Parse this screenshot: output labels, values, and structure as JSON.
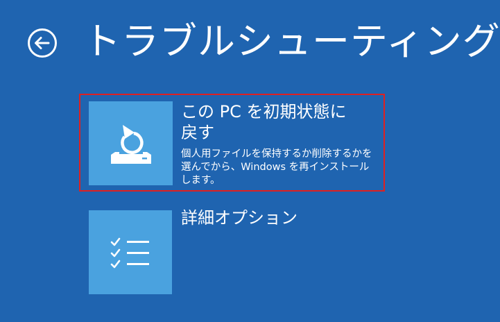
{
  "header": {
    "back_icon": "back-arrow-circle-icon",
    "title": "トラブルシューティング"
  },
  "options": [
    {
      "icon": "reset-pc-icon",
      "title_line1": "この PC を初期状態に",
      "title_line2": "戻す",
      "description": "個人用ファイルを保持するか削除するかを選んでから、Windows を再インストールします。",
      "highlighted": true,
      "highlight_color": "#e02020"
    },
    {
      "icon": "checklist-icon",
      "title_line1": "詳細オプション"
    }
  ],
  "colors": {
    "background": "#1f64b0",
    "tile": "#4aa2df",
    "text": "#ffffff"
  }
}
